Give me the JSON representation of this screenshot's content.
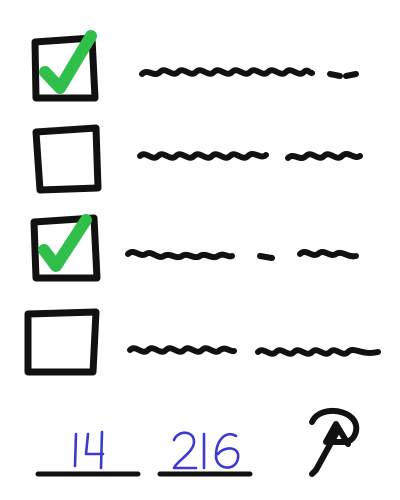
{
  "checklist": {
    "items": [
      {
        "checked": true
      },
      {
        "checked": false
      },
      {
        "checked": true
      },
      {
        "checked": false
      }
    ]
  },
  "footer": {
    "page_current": "14",
    "page_total": "216"
  },
  "colors": {
    "ink": "#111111",
    "check": "#2fbf4a",
    "pen": "#3a3ad0"
  },
  "icons": {
    "footer_logo": "handwritten-a-logo-icon"
  }
}
